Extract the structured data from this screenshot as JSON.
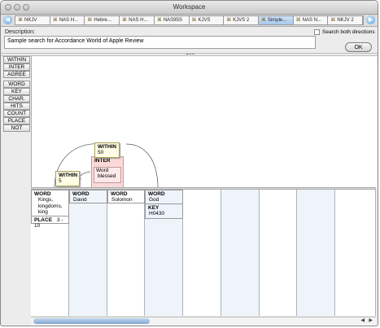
{
  "window": {
    "title": "Workspace"
  },
  "tabs": [
    {
      "label": "NKJV",
      "active": false
    },
    {
      "label": "NAS H...",
      "active": false
    },
    {
      "label": "Hebre...",
      "active": false
    },
    {
      "label": "NAS H...",
      "active": false
    },
    {
      "label": "NAS95S",
      "active": false
    },
    {
      "label": "KJVS",
      "active": false
    },
    {
      "label": "KJVS 2",
      "active": false
    },
    {
      "label": "Simple...",
      "active": true
    },
    {
      "label": "NAS N...",
      "active": false
    },
    {
      "label": "NKJV 2",
      "active": false
    }
  ],
  "description": {
    "label": "Description:",
    "value": "Sample search for Accordance World of Apple Review",
    "search_both_label": "Search both directions",
    "ok_label": "OK"
  },
  "palette": [
    "WITHIN",
    "INTER",
    "AGREE",
    "WORD",
    "KEY",
    "CHAR.",
    "HITS",
    "COUNT",
    "PLACE",
    "NOT"
  ],
  "nodes": {
    "within1": {
      "head": "WITHIN",
      "value": "5"
    },
    "within2": {
      "head": "WITHIN",
      "value": "50"
    },
    "inter": {
      "head": "INTER",
      "inner_head": "Word",
      "inner_value": "blessed"
    },
    "col1": {
      "head": "WORD",
      "lines": [
        "Kings,",
        "kingdoms,",
        "king"
      ],
      "place_label": "PLACE",
      "place_value": "3 - 10"
    },
    "col2": {
      "head": "WORD",
      "value": "David"
    },
    "col3": {
      "head": "WORD",
      "value": "Solomon"
    },
    "col4": {
      "head": "WORD",
      "value": "God",
      "key_head": "KEY",
      "key_value": "H0430"
    }
  },
  "icons": {
    "tab_icon": "book-icon",
    "nav_left": "back-arrow-icon",
    "nav_right": "forward-arrow-icon"
  }
}
